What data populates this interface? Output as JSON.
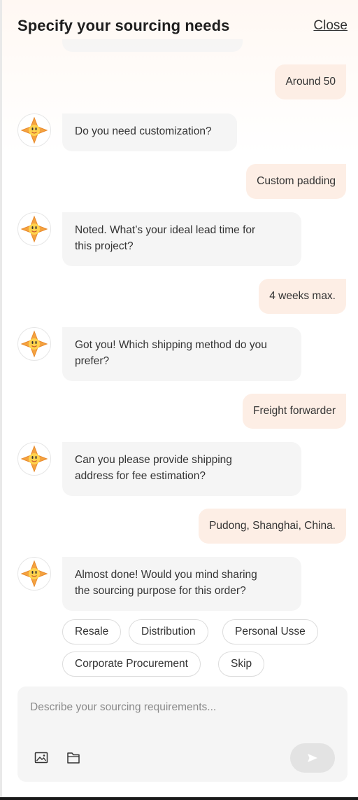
{
  "header": {
    "title": "Specify your sourcing needs",
    "close_label": "Close"
  },
  "messages": [
    {
      "role": "user",
      "text": "Around 50"
    },
    {
      "role": "bot",
      "text": "Do you need customization?"
    },
    {
      "role": "user",
      "text": "Custom padding"
    },
    {
      "role": "bot",
      "lines": [
        "Noted. What’s your ideal lead time for",
        "this project?"
      ]
    },
    {
      "role": "user",
      "text": "4 weeks max."
    },
    {
      "role": "bot",
      "lines": [
        "Got you! Which shipping method do you",
        "prefer?"
      ]
    },
    {
      "role": "user",
      "text": "Freight forwarder"
    },
    {
      "role": "bot",
      "lines": [
        "Can you please provide shipping",
        "address for fee estimation?"
      ]
    },
    {
      "role": "user",
      "text": "Pudong, Shanghai, China."
    },
    {
      "role": "bot",
      "lines": [
        "Almost done! Would you mind sharing",
        "the sourcing purpose for this order?"
      ]
    }
  ],
  "quick_replies": [
    "Resale",
    "Distribution",
    "Personal Usse",
    "Corporate Procurement",
    "Skip"
  ],
  "composer": {
    "placeholder": "Describe your sourcing requirements...",
    "icons": [
      "image-icon",
      "folder-icon",
      "send-icon"
    ]
  },
  "colors": {
    "user_bubble": "#fdeee5",
    "bot_bubble": "#f5f5f5",
    "avatar_star": "#f4a340"
  }
}
